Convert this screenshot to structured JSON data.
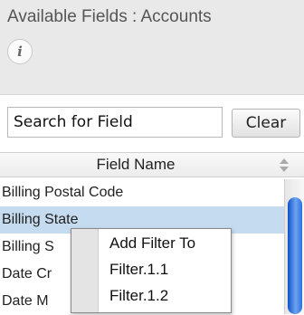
{
  "header": {
    "title": "Available Fields : Accounts",
    "info_icon": "info-icon"
  },
  "search": {
    "value": "Search for Field",
    "clear_label": "Clear"
  },
  "table": {
    "column_header": "Field Name",
    "sort_icon": "sort-icon",
    "rows": [
      {
        "label": "Billing Postal Code",
        "selected": false
      },
      {
        "label": "Billing State",
        "selected": true
      },
      {
        "label": "Billing S",
        "selected": false
      },
      {
        "label": "Date Cr",
        "selected": false
      },
      {
        "label": "Date M",
        "selected": false
      }
    ]
  },
  "context_menu": {
    "title": "Add Filter To",
    "items": [
      "Filter.1.1",
      "Filter.1.2"
    ]
  },
  "colors": {
    "selected_row": "#c5dbef",
    "scroll_thumb": "#2c6fe0"
  }
}
